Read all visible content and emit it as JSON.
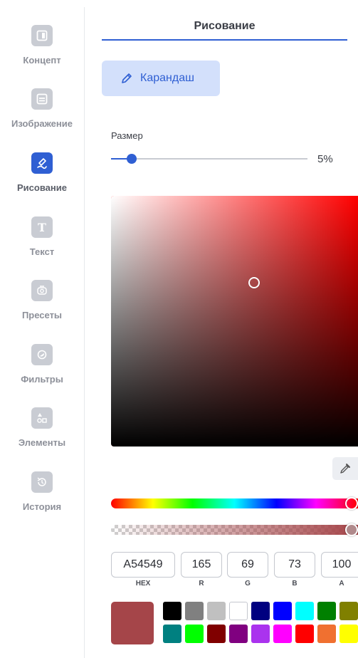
{
  "sidebar": {
    "items": [
      {
        "label": "Концепт",
        "icon": "layout-icon"
      },
      {
        "label": "Изображение",
        "icon": "image-icon"
      },
      {
        "label": "Рисование",
        "icon": "draw-icon",
        "active": true
      },
      {
        "label": "Текст",
        "icon": "text-icon"
      },
      {
        "label": "Пресеты",
        "icon": "presets-icon"
      },
      {
        "label": "Фильтры",
        "icon": "filters-icon"
      },
      {
        "label": "Элементы",
        "icon": "elements-icon"
      },
      {
        "label": "История",
        "icon": "history-icon"
      }
    ]
  },
  "header": {
    "title": "Рисование"
  },
  "tool": {
    "label": "Карандаш",
    "icon": "pencil-icon"
  },
  "size": {
    "label": "Размер",
    "value_text": "5%",
    "value": 0.05
  },
  "color": {
    "hex": "A54549",
    "r": "165",
    "g": "69",
    "b": "73",
    "a": "100",
    "labels": {
      "hex": "HEX",
      "r": "R",
      "g": "G",
      "b": "B",
      "a": "A"
    },
    "current": "#a54549",
    "picker_hue": "#ff0000"
  },
  "swatches": {
    "row1": [
      "#000000",
      "#808080",
      "#c0c0c0",
      "#ffffff",
      "#000080",
      "#0000ff",
      "#00ffff",
      "#008000",
      "#808000"
    ],
    "row2": [
      "#008080",
      "#00ff00",
      "#800000",
      "#800080",
      "#aa33ee",
      "#ff00ff",
      "#ff0000",
      "#f07030",
      "#ffff00"
    ]
  },
  "colors": {
    "accent": "#2f5fd3",
    "accent_light": "#d3e0fb",
    "icon_inactive": "#c9ccd3"
  }
}
